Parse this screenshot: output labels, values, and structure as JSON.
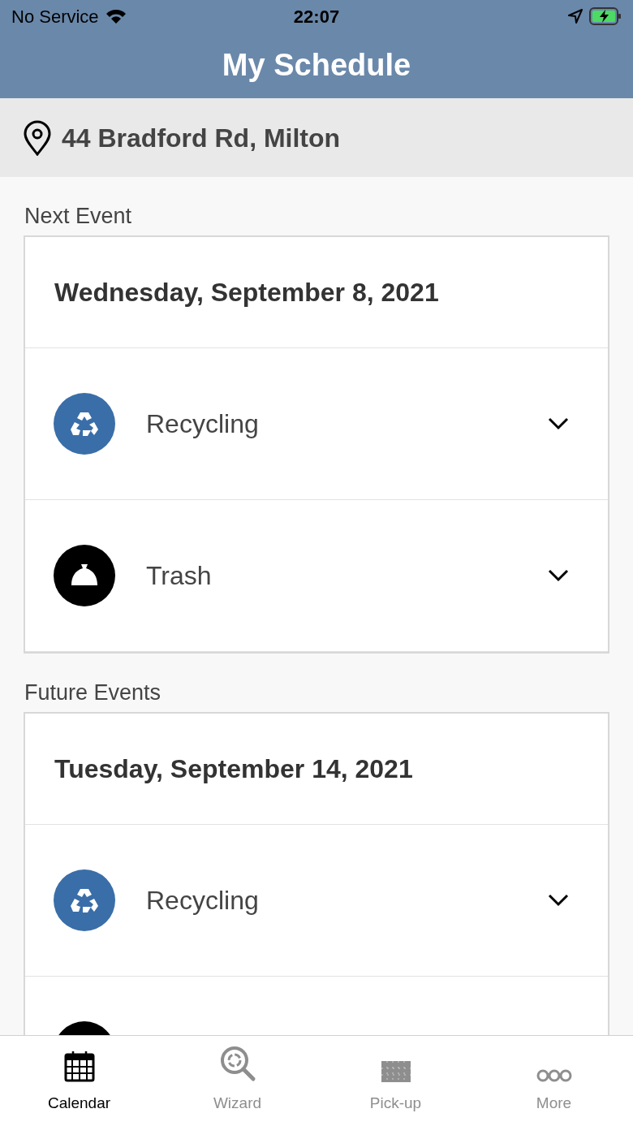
{
  "status_bar": {
    "carrier": "No Service",
    "time": "22:07"
  },
  "header": {
    "title": "My Schedule"
  },
  "address": "44 Bradford Rd, Milton",
  "sections": [
    {
      "label": "Next Event",
      "date": "Wednesday, September 8, 2021",
      "items": [
        {
          "kind": "recycling",
          "label": "Recycling"
        },
        {
          "kind": "trash",
          "label": "Trash"
        }
      ]
    },
    {
      "label": "Future Events",
      "date": "Tuesday, September 14, 2021",
      "items": [
        {
          "kind": "recycling",
          "label": "Recycling"
        },
        {
          "kind": "trash"
        }
      ]
    }
  ],
  "tabs": [
    {
      "kind": "calendar",
      "label": "Calendar",
      "selected": true
    },
    {
      "kind": "wizard",
      "label": "Wizard",
      "selected": false
    },
    {
      "kind": "pickup",
      "label": "Pick-up",
      "selected": false
    },
    {
      "kind": "more",
      "label": "More",
      "selected": false
    }
  ]
}
